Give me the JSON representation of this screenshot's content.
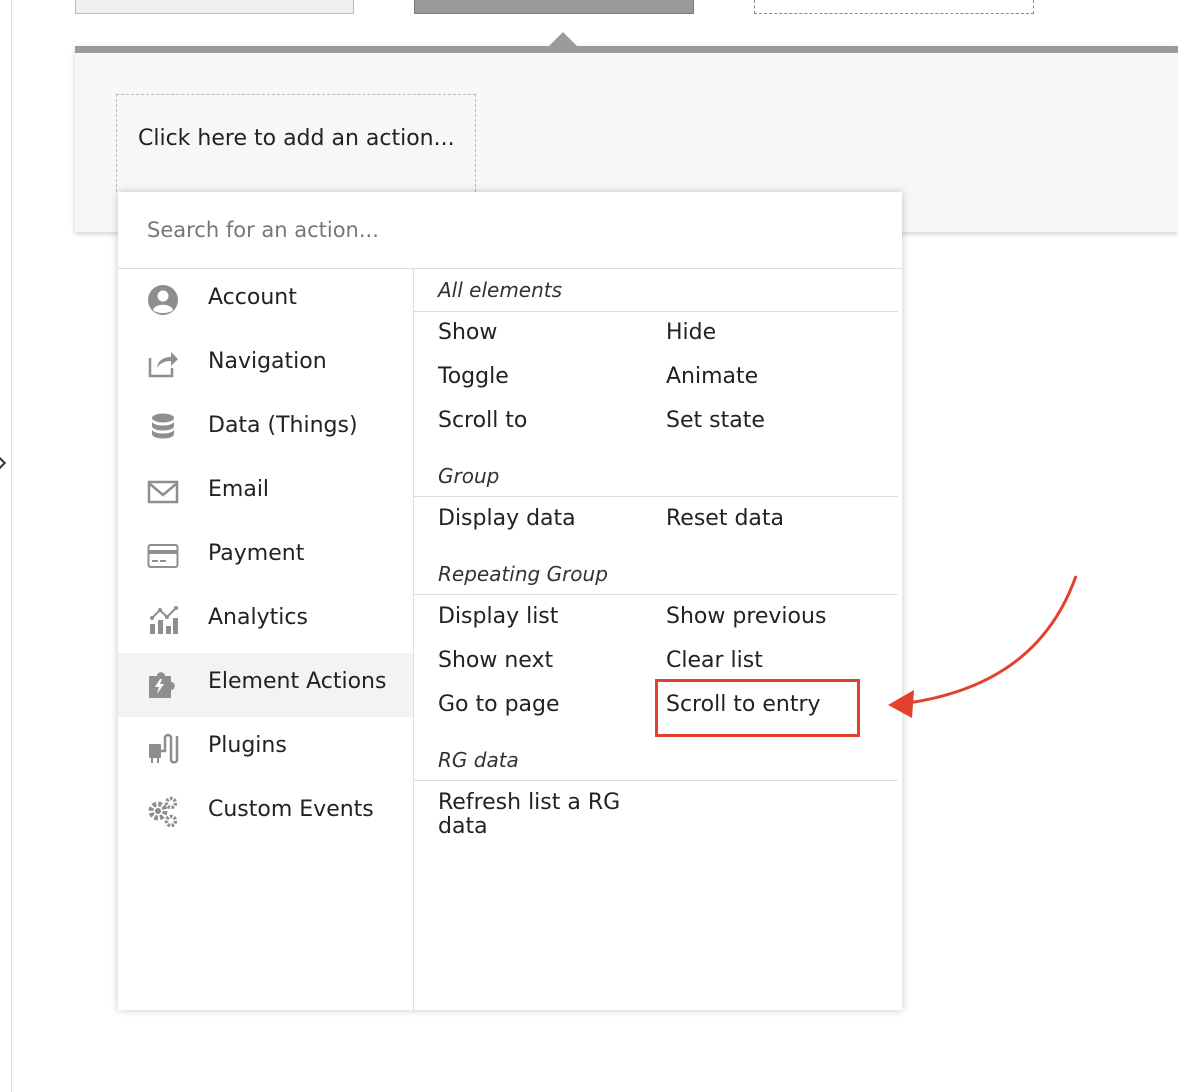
{
  "add_action": {
    "label": "Click here to add an action..."
  },
  "search": {
    "placeholder": "Search for an action..."
  },
  "categories": [
    {
      "label": "Account",
      "icon": "account-icon"
    },
    {
      "label": "Navigation",
      "icon": "navigation-icon"
    },
    {
      "label": "Data (Things)",
      "icon": "database-icon"
    },
    {
      "label": "Email",
      "icon": "email-icon"
    },
    {
      "label": "Payment",
      "icon": "credit-card-icon"
    },
    {
      "label": "Analytics",
      "icon": "analytics-icon"
    },
    {
      "label": "Element Actions",
      "icon": "puzzle-icon",
      "active": true
    },
    {
      "label": "Plugins",
      "icon": "plug-icon"
    },
    {
      "label": "Custom Events",
      "icon": "gears-icon"
    }
  ],
  "sections": [
    {
      "title": "All elements",
      "items": [
        "Show",
        "Hide",
        "Toggle",
        "Animate",
        "Scroll to",
        "Set state"
      ]
    },
    {
      "title": "Group",
      "items": [
        "Display data",
        "Reset data"
      ]
    },
    {
      "title": "Repeating Group",
      "items": [
        "Display list",
        "Show previous",
        "Show next",
        "Clear list",
        "Go to page",
        "Scroll to entry"
      ]
    },
    {
      "title": "RG data",
      "items": [
        "Refresh list a RG data"
      ]
    }
  ],
  "annotation": {
    "highlighted_item": "Scroll to entry",
    "color": "#e2412d"
  }
}
